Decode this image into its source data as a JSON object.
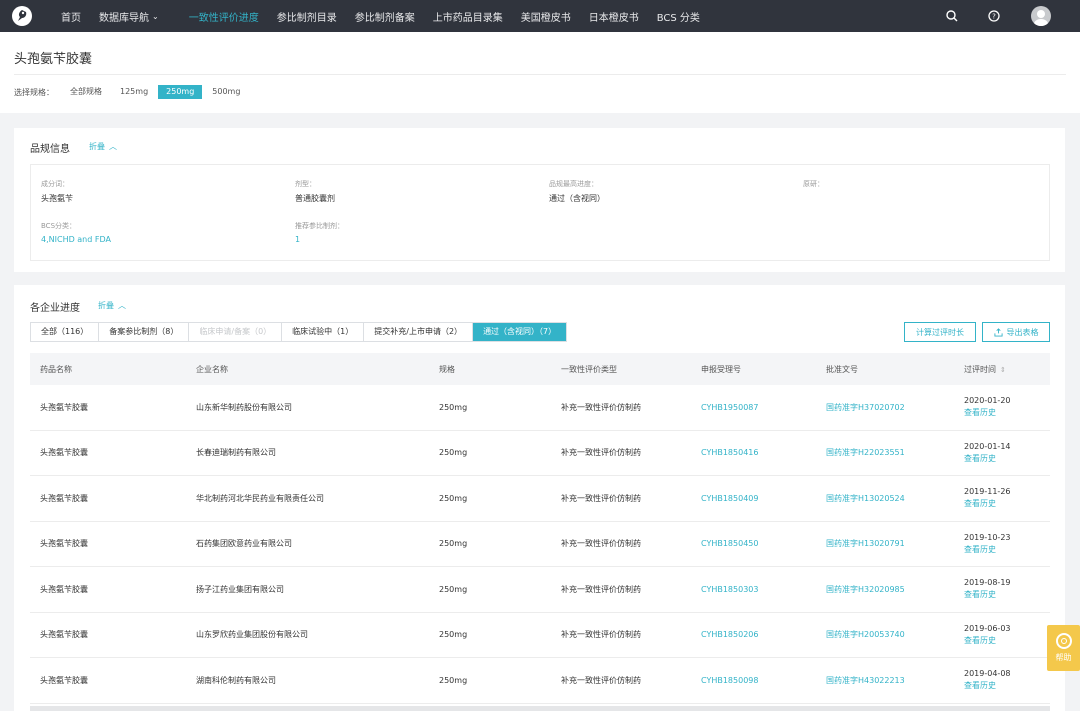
{
  "nav": {
    "items": [
      {
        "label": "首页",
        "active": false
      },
      {
        "label": "数据库导航",
        "active": false,
        "dropdown": true
      },
      {
        "label": "一致性评价进度",
        "active": true
      },
      {
        "label": "参比制剂目录",
        "active": false
      },
      {
        "label": "参比制剂备案",
        "active": false
      },
      {
        "label": "上市药品目录集",
        "active": false
      },
      {
        "label": "美国橙皮书",
        "active": false
      },
      {
        "label": "日本橙皮书",
        "active": false
      },
      {
        "label": "BCS 分类",
        "active": false
      }
    ],
    "chevron": "⌄",
    "icons": [
      "search-icon",
      "help-circle-icon",
      "user-avatar"
    ]
  },
  "page": {
    "title": "头孢氨苄胶囊",
    "spec_label": "选择规格：",
    "spec_options": [
      "全部规格",
      "125mg",
      "250mg",
      "500mg"
    ],
    "spec_selected": "250mg"
  },
  "quality_info": {
    "title": "品规信息",
    "collapse": "折叠",
    "fields": [
      {
        "label": "成分词：",
        "value": "头孢氨苄",
        "link": false
      },
      {
        "label": "剂型：",
        "value": "普通胶囊剂",
        "link": false
      },
      {
        "label": "品规最高进度：",
        "value": "通过（含视同）",
        "link": false
      },
      {
        "label": "原研：",
        "value": "",
        "link": false
      },
      {
        "label": "BCS分类：",
        "value": "4,NICHD and FDA",
        "link": true
      },
      {
        "label": "推荐参比制剂：",
        "value": "1",
        "link": true
      }
    ]
  },
  "progress": {
    "title": "各企业进度",
    "collapse": "折叠",
    "tabs": [
      {
        "label": "全部（116）",
        "state": "normal"
      },
      {
        "label": "备案参比制剂（8）",
        "state": "normal"
      },
      {
        "label": "临床申请/备案（0）",
        "state": "disabled"
      },
      {
        "label": "临床试验中（1）",
        "state": "normal"
      },
      {
        "label": "提交补充/上市申请（2）",
        "state": "normal"
      },
      {
        "label": "通过（含视同）（7）",
        "state": "active"
      }
    ],
    "btn_calc": "计算过评时长",
    "btn_export": "导出表格",
    "columns": [
      "药品名称",
      "企业名称",
      "规格",
      "一致性评价类型",
      "申报受理号",
      "批准文号",
      "过评时间"
    ],
    "history_label": "查看历史",
    "rows": [
      {
        "drug": "头孢氨苄胶囊",
        "company": "山东新华制药股份有限公司",
        "spec": "250mg",
        "type": "补充一致性评价仿制药",
        "accept_no": "CYHB1950087",
        "approval_no": "国药准字H37020702",
        "date": "2020-01-20"
      },
      {
        "drug": "头孢氨苄胶囊",
        "company": "长春迪瑞制药有限公司",
        "spec": "250mg",
        "type": "补充一致性评价仿制药",
        "accept_no": "CYHB1850416",
        "approval_no": "国药准字H22023551",
        "date": "2020-01-14"
      },
      {
        "drug": "头孢氨苄胶囊",
        "company": "华北制药河北华民药业有限责任公司",
        "spec": "250mg",
        "type": "补充一致性评价仿制药",
        "accept_no": "CYHB1850409",
        "approval_no": "国药准字H13020524",
        "date": "2019-11-26"
      },
      {
        "drug": "头孢氨苄胶囊",
        "company": "石药集团欧意药业有限公司",
        "spec": "250mg",
        "type": "补充一致性评价仿制药",
        "accept_no": "CYHB1850450",
        "approval_no": "国药准字H13020791",
        "date": "2019-10-23"
      },
      {
        "drug": "头孢氨苄胶囊",
        "company": "扬子江药业集团有限公司",
        "spec": "250mg",
        "type": "补充一致性评价仿制药",
        "accept_no": "CYHB1850303",
        "approval_no": "国药准字H32020985",
        "date": "2019-08-19"
      },
      {
        "drug": "头孢氨苄胶囊",
        "company": "山东罗欣药业集团股份有限公司",
        "spec": "250mg",
        "type": "补充一致性评价仿制药",
        "accept_no": "CYHB1850206",
        "approval_no": "国药准字H20053740",
        "date": "2019-06-03"
      },
      {
        "drug": "头孢氨苄胶囊",
        "company": "湖南科伦制药有限公司",
        "spec": "250mg",
        "type": "补充一致性评价仿制药",
        "accept_no": "CYHB1850098",
        "approval_no": "国药准字H43022213",
        "date": "2019-04-08"
      }
    ]
  },
  "help": {
    "label": "帮助"
  },
  "colors": {
    "accent": "#33b3c8",
    "nav_bg": "#30343d",
    "help_bg": "#f4c84b"
  }
}
